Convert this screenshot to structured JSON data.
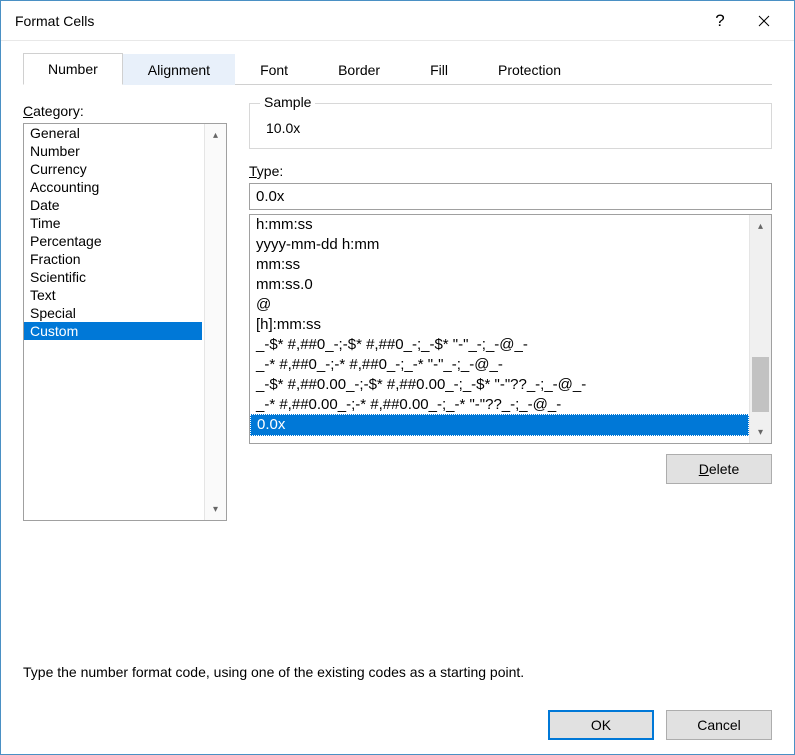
{
  "title": "Format Cells",
  "tabs": [
    {
      "label": "Number",
      "active": true
    },
    {
      "label": "Alignment",
      "active": false,
      "highlight": true
    },
    {
      "label": "Font",
      "active": false
    },
    {
      "label": "Border",
      "active": false
    },
    {
      "label": "Fill",
      "active": false
    },
    {
      "label": "Protection",
      "active": false
    }
  ],
  "category_label": "Category:",
  "categories": [
    "General",
    "Number",
    "Currency",
    "Accounting",
    "Date",
    "Time",
    "Percentage",
    "Fraction",
    "Scientific",
    "Text",
    "Special",
    "Custom"
  ],
  "selected_category_index": 11,
  "sample_label": "Sample",
  "sample_value": "10.0x",
  "type_label": "Type:",
  "type_value": "0.0x",
  "format_codes": [
    "h:mm:ss",
    "yyyy-mm-dd h:mm",
    "mm:ss",
    "mm:ss.0",
    "@",
    "[h]:mm:ss",
    "_-$* #,##0_-;-$* #,##0_-;_-$* \"-\"_-;_-@_-",
    "_-* #,##0_-;-* #,##0_-;_-* \"-\"_-;_-@_-",
    "_-$* #,##0.00_-;-$* #,##0.00_-;_-$* \"-\"??_-;_-@_-",
    "_-* #,##0.00_-;-* #,##0.00_-;_-* \"-\"??_-;_-@_-",
    "0.0x"
  ],
  "selected_format_index": 10,
  "delete_label": "Delete",
  "hint": "Type the number format code, using one of the existing codes as a starting point.",
  "ok_label": "OK",
  "cancel_label": "Cancel"
}
